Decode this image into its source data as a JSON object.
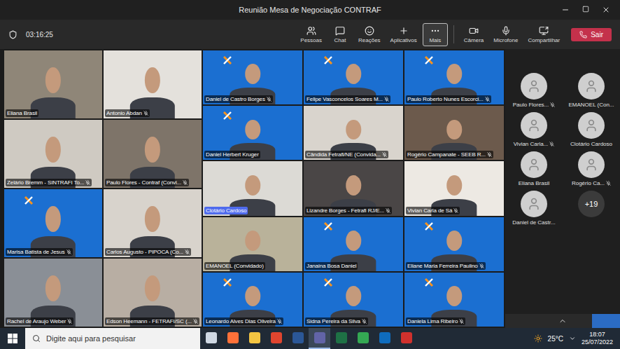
{
  "window": {
    "title": "Reunião Mesa de Negociação CONTRAF"
  },
  "meeting_toolbar": {
    "timer": "03:16:25",
    "actions": [
      {
        "label": "Pessoas",
        "selected": false
      },
      {
        "label": "Chat",
        "selected": false
      },
      {
        "label": "Reações",
        "selected": false
      },
      {
        "label": "Aplicativos",
        "selected": false
      },
      {
        "label": "Mais",
        "selected": true
      }
    ],
    "devices": [
      {
        "label": "Câmera"
      },
      {
        "label": "Microfone"
      },
      {
        "label": "Compartilhar"
      }
    ],
    "leave": {
      "label": "Sair"
    }
  },
  "grid": {
    "large_tiles": [
      {
        "name": "Eliana Brasil",
        "muted": false,
        "speaking": false,
        "kind": "camera",
        "color": "#8f8678"
      },
      {
        "name": "Antonio Abdan",
        "muted": true,
        "speaking": false,
        "kind": "camera",
        "color": "#e4e1dc"
      },
      {
        "name": "Zelário Bremm - SINTRAFI To...",
        "muted": true,
        "speaking": false,
        "kind": "camera",
        "color": "#cfcac2"
      },
      {
        "name": "Paulo Flores - Contraf (Convi...",
        "muted": true,
        "speaking": false,
        "kind": "camera",
        "color": "#7e7469"
      },
      {
        "name": "Marisa Batista de Jesus",
        "muted": true,
        "speaking": false,
        "kind": "branded",
        "color": "#1b6fd1"
      },
      {
        "name": "Carlos Augusto - PIPOCA (Co...",
        "muted": true,
        "speaking": false,
        "kind": "camera",
        "color": "#d8d3cc"
      },
      {
        "name": "Rachel de Araujo Weber",
        "muted": true,
        "speaking": false,
        "kind": "camera",
        "color": "#8a8f96"
      },
      {
        "name": "Edson Heemann - FETRAFI/SC (...",
        "muted": true,
        "speaking": false,
        "kind": "camera",
        "color": "#b8aea3"
      }
    ],
    "small_tiles": [
      {
        "name": "Daniel de Castro Borges",
        "muted": true,
        "speaking": false,
        "kind": "branded",
        "color": "#1b6fd1"
      },
      {
        "name": "Felipe Vasconcelos Soares M...",
        "muted": true,
        "speaking": false,
        "kind": "branded",
        "color": "#1b6fd1"
      },
      {
        "name": "Paulo Roberto Nunes Escorci...",
        "muted": true,
        "speaking": false,
        "kind": "branded",
        "color": "#1b6fd1"
      },
      {
        "name": "Daniel Herbert Kruger",
        "muted": false,
        "speaking": false,
        "kind": "branded",
        "color": "#1b6fd1"
      },
      {
        "name": "Cândida Fetrafi/NE (Convida...",
        "muted": true,
        "speaking": false,
        "kind": "camera",
        "color": "#d9d4cd"
      },
      {
        "name": "Rogério Campanate - SEEB R...",
        "muted": true,
        "speaking": false,
        "kind": "camera",
        "color": "#6c5a4c"
      },
      {
        "name": "Clotário Cardoso",
        "muted": false,
        "speaking": true,
        "kind": "camera",
        "color": "#dcdad5"
      },
      {
        "name": "Lizandre Borges - Fetrafi RJ/E...",
        "muted": true,
        "speaking": false,
        "kind": "camera",
        "color": "#4a4646"
      },
      {
        "name": "Vivian Carla de Sá",
        "muted": true,
        "speaking": false,
        "kind": "camera",
        "color": "#ede9e3"
      },
      {
        "name": "EMANOEL (Convidado)",
        "muted": false,
        "speaking": false,
        "kind": "camera",
        "color": "#b9b29a"
      },
      {
        "name": "Janaina Bosa Daniel",
        "muted": false,
        "speaking": false,
        "kind": "branded",
        "color": "#1b6fd1"
      },
      {
        "name": "Eliane Maria Ferreira Paulino",
        "muted": true,
        "speaking": false,
        "kind": "branded",
        "color": "#1b6fd1"
      },
      {
        "name": "Leonardo Alves Dias Oliveira",
        "muted": true,
        "speaking": false,
        "kind": "branded",
        "color": "#1b6fd1"
      },
      {
        "name": "Sidna Pereira da Silva",
        "muted": true,
        "speaking": false,
        "kind": "branded",
        "color": "#1b6fd1"
      },
      {
        "name": "Daniela Lima Ribeiro",
        "muted": true,
        "speaking": false,
        "kind": "branded",
        "color": "#1b6fd1"
      }
    ]
  },
  "roster": {
    "people": [
      {
        "name": "Paulo Flores...",
        "muted": true
      },
      {
        "name": "EMANOEL (Con...",
        "muted": false
      },
      {
        "name": "Vivian Carla...",
        "muted": true
      },
      {
        "name": "Clotário Cardoso",
        "muted": false
      },
      {
        "name": "Eliana Brasil",
        "muted": false
      },
      {
        "name": "Rogério Ca...",
        "muted": true
      },
      {
        "name": "Daniel de Castr...",
        "muted": false
      }
    ],
    "overflow": "+19"
  },
  "taskbar": {
    "search_placeholder": "Digite aqui para pesquisar",
    "apps": [
      {
        "color": "#cfd8e3",
        "active": false
      },
      {
        "color": "#ff7139",
        "active": false
      },
      {
        "color": "#f4c542",
        "active": false
      },
      {
        "color": "#e0452f",
        "active": false
      },
      {
        "color": "#2b5797",
        "active": false
      },
      {
        "color": "#6264a7",
        "active": true
      },
      {
        "color": "#1e7145",
        "active": false
      },
      {
        "color": "#34a853",
        "active": false
      },
      {
        "color": "#0f6cbd",
        "active": false
      },
      {
        "color": "#d0312d",
        "active": false
      }
    ],
    "weather": "25°C",
    "time": "18:07",
    "date": "25/07/2022"
  }
}
